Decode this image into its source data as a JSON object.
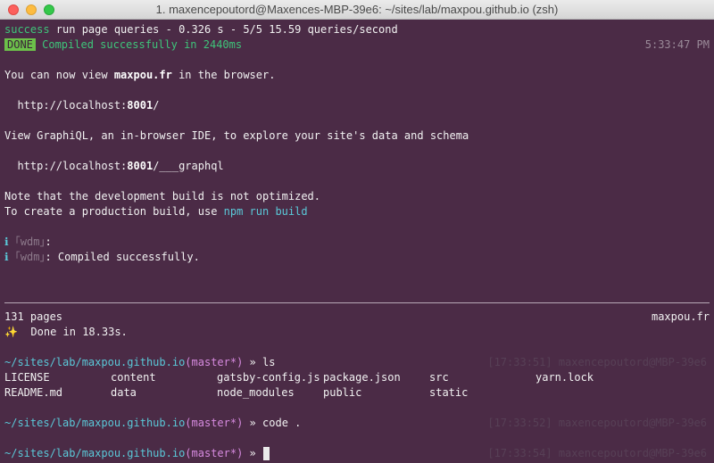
{
  "window": {
    "title": "1. maxencepoutord@Maxences-MBP-39e6: ~/sites/lab/maxpou.github.io (zsh)"
  },
  "lines": {
    "success_word": "success",
    "success_rest": " run page queries - 0.326 s - 5/5 15.59 queries/second",
    "done_badge": "DONE",
    "compiled": " Compiled successfully in 2440ms",
    "compiled_time": "5:33:47 PM",
    "view_pre": "You can now view ",
    "view_site": "maxpou.fr",
    "view_post": " in the browser.",
    "url1_pre": "  http://localhost:",
    "url1_port": "8001",
    "url1_post": "/",
    "graphiql": "View GraphiQL, an in-browser IDE, to explore your site's data and schema",
    "url2_pre": "  http://localhost:",
    "url2_port": "8001",
    "url2_post": "/___graphql",
    "note": "Note that the development build is not optimized.",
    "prod_pre": "To create a production build, use ",
    "prod_cmd": "npm run build",
    "wdm_icon": "ℹ",
    "wdm_tag": "｢wdm｣",
    "wdm1_rest": ":",
    "wdm2_rest": ": Compiled successfully.",
    "pages": "131 pages",
    "pages_site": "maxpou.fr",
    "sparkles": "✨",
    "done_in": "  Done in 18.33s."
  },
  "prompts": [
    {
      "path": "~/sites/lab/maxpou.github.io",
      "git": "(master*)",
      "arrow": " » ",
      "cmd": "ls"
    },
    {
      "path": "~/sites/lab/maxpou.github.io",
      "git": "(master*)",
      "arrow": " » ",
      "cmd": "code ."
    },
    {
      "path": "~/sites/lab/maxpou.github.io",
      "git": "(master*)",
      "arrow": " » ",
      "cmd": ""
    }
  ],
  "ls": [
    {
      "name": "LICENSE",
      "type": "file"
    },
    {
      "name": "content",
      "type": "dir"
    },
    {
      "name": "gatsby-config.js",
      "type": "file"
    },
    {
      "name": "package.json",
      "type": "file"
    },
    {
      "name": "src",
      "type": "dir"
    },
    {
      "name": "yarn.lock",
      "type": "file"
    },
    {
      "name": "README.md",
      "type": "file"
    },
    {
      "name": "data",
      "type": "dir"
    },
    {
      "name": "node_modules",
      "type": "dir"
    },
    {
      "name": "public",
      "type": "dir"
    },
    {
      "name": "static",
      "type": "dir"
    }
  ],
  "colors": {
    "background": "#4b2b46",
    "text": "#f2f2f2",
    "success": "#3ec57a",
    "directory": "#5ac8d8",
    "badge": "#6cc04a"
  }
}
